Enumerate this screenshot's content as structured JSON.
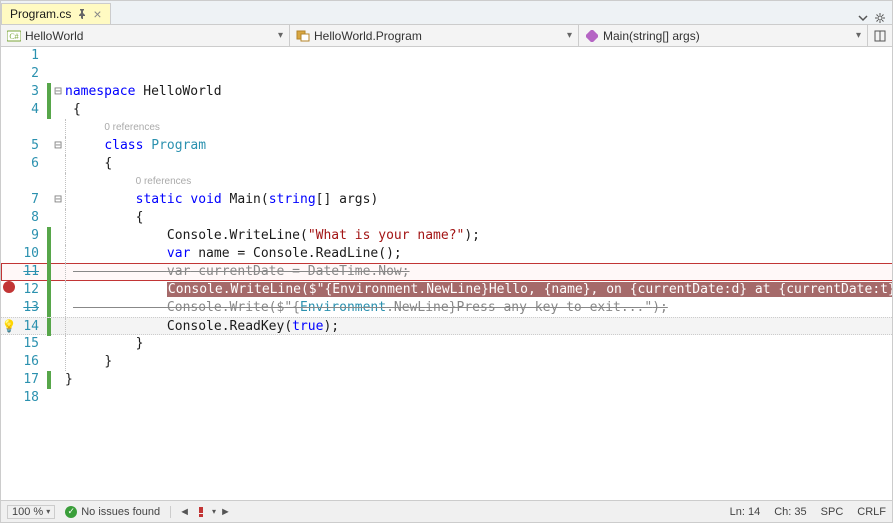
{
  "tab": {
    "name": "Program.cs",
    "pinned": true
  },
  "nav": {
    "scope1": "HelloWorld",
    "scope2": "HelloWorld.Program",
    "scope3": "Main(string[] args)"
  },
  "codelens": {
    "refs": "0 references"
  },
  "code": {
    "ns_kw": "namespace",
    "ns_name": " HelloWorld",
    "class_kw": "class",
    "class_name": "Program",
    "static_kw": "static",
    "void_kw": "void",
    "main": " Main(",
    "string_kw": "string",
    "args": "[] args)",
    "cw1_a": "Console.WriteLine(",
    "cw1_b": "\"What is your name?\"",
    "cw1_c": ");",
    "var_kw": "var",
    "name_a": " name = Console.ReadLine();",
    "cd_a": " currentDate = DateTime.Now;",
    "l12": "Console.WriteLine($\"{Environment.NewLine}Hello, {name}, on {currentDate:d} at {currentDate:t}!\");",
    "l13_a": "Console.Write($",
    "l13_b": "\"{",
    "l13_c": "Environment",
    "l13_d": ".NewLine}Press any key to exit...\"",
    "l13_e": ");",
    "rk_a": "Console.ReadKey(",
    "rk_true": "true",
    "rk_b": ");",
    "brace_o": "{",
    "brace_c": "}"
  },
  "lines": [
    "1",
    "2",
    "3",
    "4",
    "5",
    "6",
    "7",
    "8",
    "9",
    "10",
    "11",
    "12",
    "13",
    "14",
    "15",
    "16",
    "17",
    "18"
  ],
  "status": {
    "zoom": "100 %",
    "issues": "No issues found",
    "ln": "Ln: 14",
    "ch": "Ch: 35",
    "spc": "SPC",
    "crlf": "CRLF"
  }
}
